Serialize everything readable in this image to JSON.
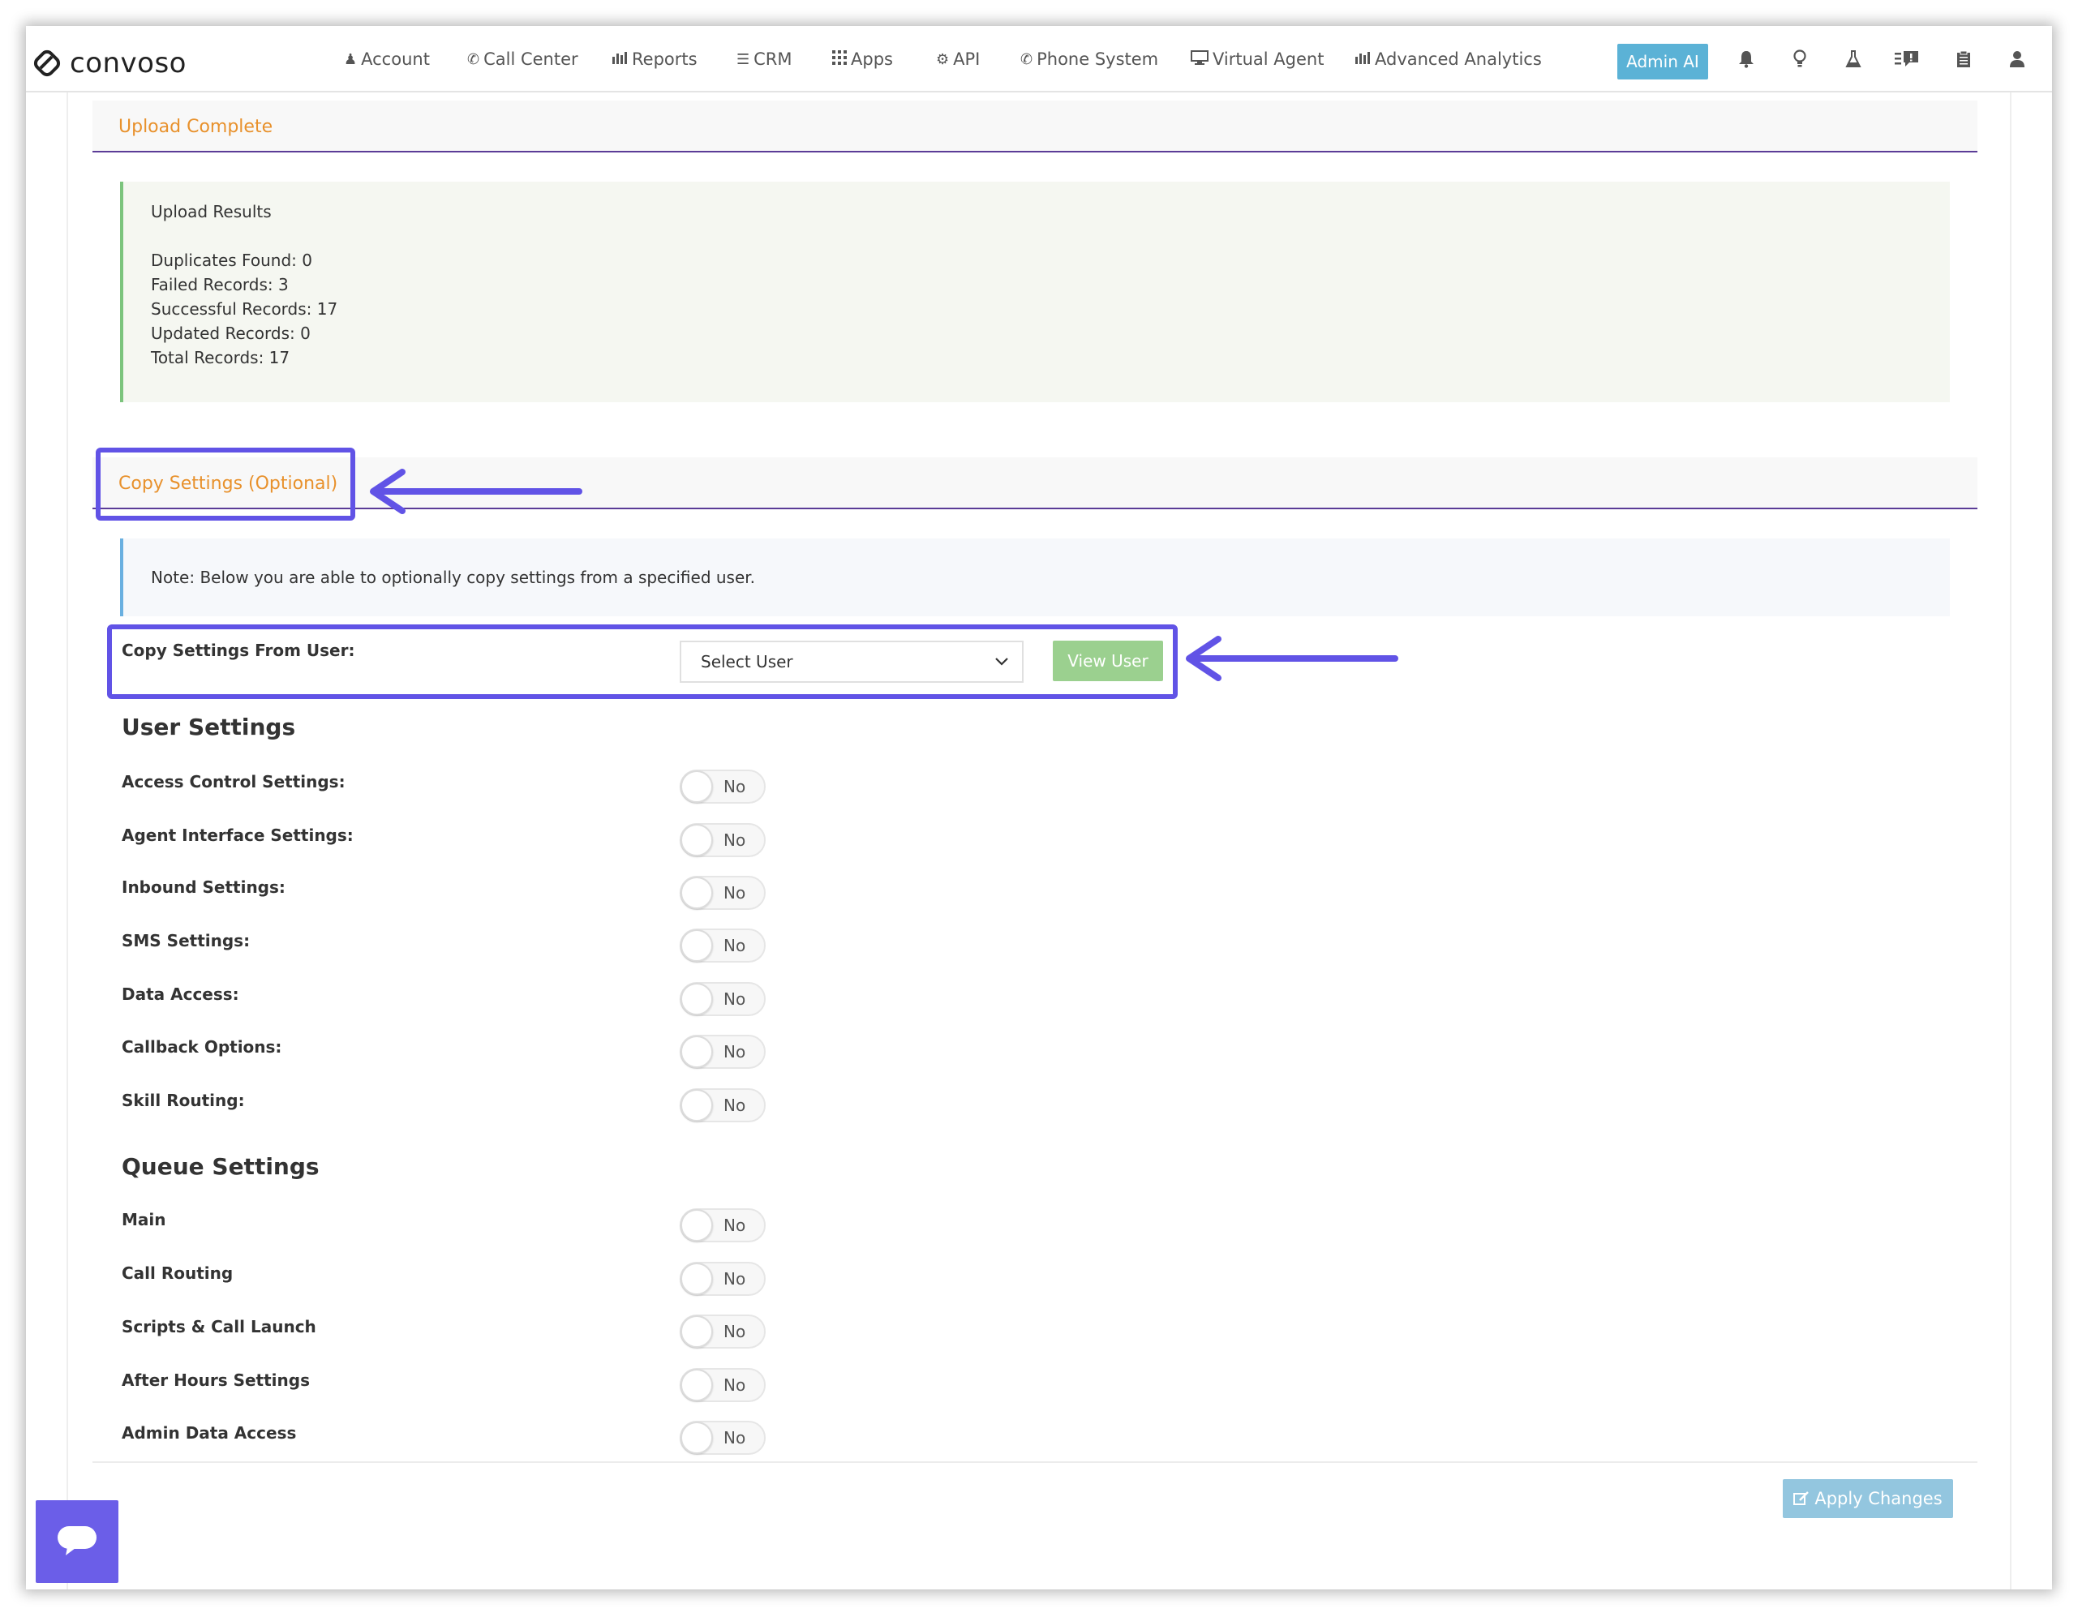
{
  "brand": {
    "name": "convoso"
  },
  "nav": {
    "items": [
      {
        "label": "Account",
        "icon": "user-icon"
      },
      {
        "label": "Call Center",
        "icon": "phone-icon"
      },
      {
        "label": "Reports",
        "icon": "bar-chart-icon"
      },
      {
        "label": "CRM",
        "icon": "list-icon"
      },
      {
        "label": "Apps",
        "icon": "grid-icon"
      },
      {
        "label": "API",
        "icon": "gear-icon"
      },
      {
        "label": "Phone System",
        "icon": "phone-icon"
      },
      {
        "label": "Virtual Agent",
        "icon": "monitor-icon"
      },
      {
        "label": "Advanced Analytics",
        "icon": "bar-chart-icon"
      }
    ],
    "admin_ai": "Admin AI",
    "right_icons": [
      "bell-icon",
      "lightbulb-icon",
      "flask-icon",
      "chat-list-icon",
      "clipboard-icon",
      "user-icon"
    ]
  },
  "upload": {
    "header": "Upload Complete",
    "results_title": "Upload Results",
    "lines": [
      "Duplicates Found: 0",
      "Failed Records: 3",
      "Successful Records: 17",
      "Updated Records: 0",
      "Total Records: 17"
    ]
  },
  "copy": {
    "header": "Copy Settings (Optional)",
    "note": "Note: Below you are able to optionally copy settings from a specified user.",
    "from_user_label": "Copy Settings From User:",
    "select_value": "Select User",
    "view_user": "View User"
  },
  "user_settings": {
    "title": "User Settings",
    "items": [
      {
        "label": "Access Control Settings:",
        "value": "No"
      },
      {
        "label": "Agent Interface Settings:",
        "value": "No"
      },
      {
        "label": "Inbound Settings:",
        "value": "No"
      },
      {
        "label": "SMS Settings:",
        "value": "No"
      },
      {
        "label": "Data Access:",
        "value": "No"
      },
      {
        "label": "Callback Options:",
        "value": "No"
      },
      {
        "label": "Skill Routing:",
        "value": "No"
      }
    ]
  },
  "queue_settings": {
    "title": "Queue Settings",
    "items": [
      {
        "label": "Main",
        "value": "No"
      },
      {
        "label": "Call Routing",
        "value": "No"
      },
      {
        "label": "Scripts & Call Launch",
        "value": "No"
      },
      {
        "label": "After Hours Settings",
        "value": "No"
      },
      {
        "label": "Admin Data Access",
        "value": "No"
      }
    ]
  },
  "footer": {
    "apply": "Apply Changes"
  },
  "colors": {
    "accent": "#6153e6",
    "orange": "#e8912c",
    "purple_line": "#5b3c97",
    "green_button": "#9bd08f",
    "blue_button": "#93c6df"
  }
}
